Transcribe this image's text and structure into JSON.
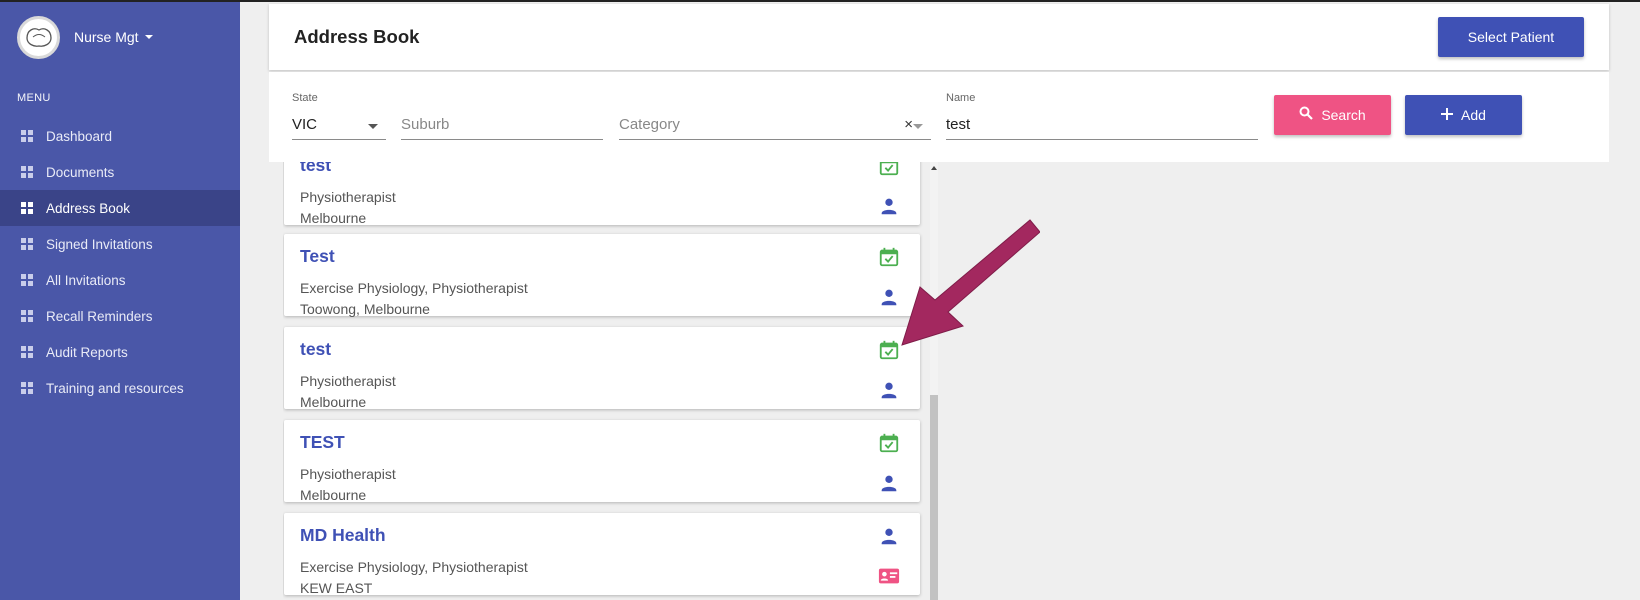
{
  "sidebar": {
    "brand": "Nurse Mgt",
    "menu_title": "MENU",
    "items": [
      {
        "label": "Dashboard"
      },
      {
        "label": "Documents"
      },
      {
        "label": "Address Book"
      },
      {
        "label": "Signed Invitations"
      },
      {
        "label": "All Invitations"
      },
      {
        "label": "Recall Reminders"
      },
      {
        "label": "Audit Reports"
      },
      {
        "label": "Training and resources"
      }
    ],
    "active_item": "Address Book"
  },
  "header": {
    "title": "Address Book",
    "select_patient_label": "Select Patient"
  },
  "filters": {
    "state": {
      "label": "State",
      "value": "VIC"
    },
    "suburb": {
      "placeholder": "Suburb"
    },
    "category": {
      "placeholder": "Category",
      "clear": "×"
    },
    "name": {
      "label": "Name",
      "value": "test"
    },
    "search_label": "Search",
    "add_label": "Add"
  },
  "results": [
    {
      "name": "test",
      "types": "Physiotherapist",
      "location": "Melbourne",
      "icons": [
        "calendar-check-icon",
        "person-icon"
      ]
    },
    {
      "name": "Test",
      "types": "Exercise Physiology, Physiotherapist",
      "location": "Toowong, Melbourne",
      "icons": [
        "calendar-check-icon",
        "person-icon"
      ]
    },
    {
      "name": "test",
      "types": "Physiotherapist",
      "location": "Melbourne",
      "icons": [
        "calendar-check-icon",
        "person-icon"
      ]
    },
    {
      "name": "TEST",
      "types": "Physiotherapist",
      "location": "Melbourne",
      "icons": [
        "calendar-check-icon",
        "person-icon"
      ]
    },
    {
      "name": "MD Health",
      "types": "Exercise Physiology, Physiotherapist",
      "location": "KEW EAST",
      "icons": [
        "person-icon",
        "contact-card-icon"
      ]
    }
  ],
  "colors": {
    "sidebar": "#4a57a8",
    "primary": "#3f51b5",
    "accent": "#ef5384",
    "calendar": "#4caf50",
    "annotation_arrow": "#a3285f"
  }
}
